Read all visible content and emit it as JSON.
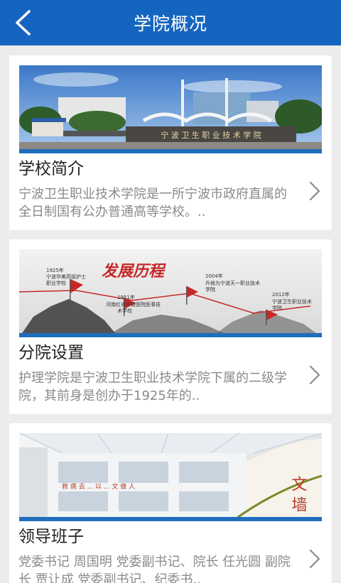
{
  "header": {
    "title": "学院概况"
  },
  "cards": [
    {
      "title": "学校简介",
      "desc": "宁波卫生职业技术学院是一所宁波市政府直属的全日制国有公办普通高等学校。..",
      "image_text": "宁 波 卫 生 职 业 技 术 学 院"
    },
    {
      "title": "分院设置",
      "desc": "护理学院是宁波卫生职业技术学院下属的二级学院，其前身是创办于1925年的..",
      "image_text": {
        "heading": "发展历程",
        "m1_year": "1925年",
        "m1_line1": "宁波华美高级护士",
        "m1_line2": "职业学校",
        "m2_year": "1951年",
        "m2_line1": "河南红省宁波医院医事技",
        "m2_line2": "术学校",
        "m3_year": "2004年",
        "m3_line1": "升格为宁波天一职业技术",
        "m3_line2": "学院",
        "m4_year": "2012年",
        "m4_line1": "宁波卫生职业技术",
        "m4_line2": "学院"
      }
    },
    {
      "title": "领导班子",
      "desc": "党委书记 周国明 党委副书记、院长 任光圆 副院长 贾让成 党委副书记、纪委书..",
      "image_text": {
        "banner": "救 病 去 ... 以 ... 文 做 人",
        "calligraphy": "文 墙"
      }
    }
  ],
  "colors": {
    "header": "#1565c0",
    "accent_bar": "#1f6ebd"
  }
}
